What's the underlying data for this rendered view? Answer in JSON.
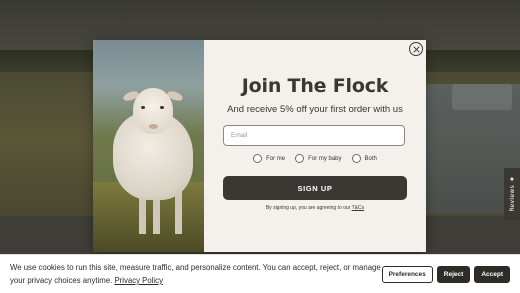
{
  "popup": {
    "title": "Join The Flock",
    "subtitle": "And receive 5% off your first order with us",
    "email_placeholder": "Email",
    "radio_options": [
      "For me",
      "For my baby",
      "Both"
    ],
    "signup_label": "SIGN UP",
    "legal_text": "By signing up, you are agreeing to our",
    "legal_link": "T&Cs",
    "close_icon": "close-icon",
    "image": "sheep-photo"
  },
  "reviews_tab": {
    "label": "Reviews",
    "icon": "star-icon"
  },
  "cookie_banner": {
    "text": "We use cookies to run this site, measure traffic, and personalize content. You can accept, reject, or manage your privacy choices anytime.",
    "policy_link": "Privacy Policy",
    "preferences_label": "Preferences",
    "reject_label": "Reject",
    "accept_label": "Accept"
  },
  "colors": {
    "dark": "#3b3833",
    "modal_bg": "#f4f0ec",
    "banner_bg": "#ffffff"
  }
}
